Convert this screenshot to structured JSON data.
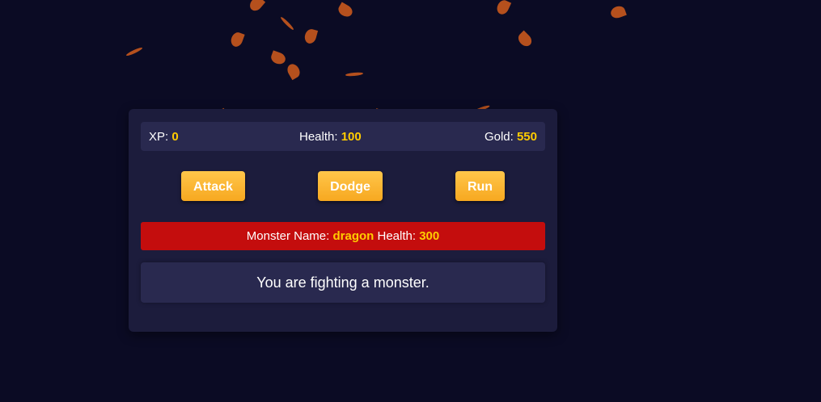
{
  "stats": {
    "xp_label": "XP:",
    "xp_value": "0",
    "health_label": "Health:",
    "health_value": "100",
    "gold_label": "Gold:",
    "gold_value": "550"
  },
  "controls": {
    "attack_label": "Attack",
    "dodge_label": "Dodge",
    "run_label": "Run"
  },
  "monster": {
    "name_label": "Monster Name:",
    "name_value": "dragon",
    "health_label": "Health:",
    "health_value": "300"
  },
  "message": "You are fighting a monster.",
  "colors": {
    "background": "#0b0b24",
    "panel": "#1c1c3c",
    "stat_bar": "#29294f",
    "accent": "#ffcc00",
    "button": "#f7b133",
    "monster_bar": "#c40d0d",
    "leaf": "#c4571d"
  },
  "decorations": {
    "falling_leaves": "leaf-icon"
  }
}
